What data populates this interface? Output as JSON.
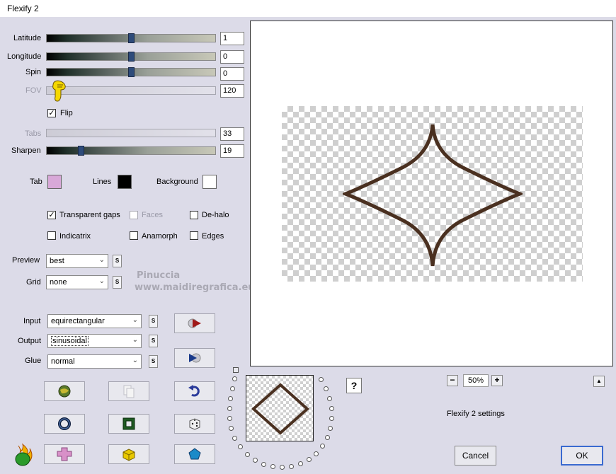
{
  "window": {
    "title": "Flexify 2"
  },
  "sliders": [
    {
      "label": "Latitude",
      "value": "1",
      "level": 0.5,
      "disabled": false
    },
    {
      "label": "Longitude",
      "value": "0",
      "level": 0.5,
      "disabled": false
    },
    {
      "label": "Spin",
      "value": "0",
      "level": 0.5,
      "disabled": false
    },
    {
      "label": "FOV",
      "value": "120",
      "level": 0.05,
      "disabled": true
    },
    {
      "label": "Tabs",
      "value": "33",
      "level": 0.0,
      "disabled": true
    },
    {
      "label": "Sharpen",
      "value": "19",
      "level": 0.2,
      "disabled": false
    }
  ],
  "flip": {
    "label": "Flip",
    "checked": true
  },
  "colors": {
    "tab": {
      "label": "Tab",
      "color": "#d8a8d8"
    },
    "lines": {
      "label": "Lines",
      "color": "#000000"
    },
    "background": {
      "label": "Background",
      "color": "#ffffff"
    }
  },
  "options": {
    "transparent_gaps": {
      "label": "Transparent gaps",
      "checked": true
    },
    "faces": {
      "label": "Faces",
      "checked": false,
      "disabled": true
    },
    "de_halo": {
      "label": "De-halo",
      "checked": false
    },
    "indicatrix": {
      "label": "Indicatrix",
      "checked": false
    },
    "anamorph": {
      "label": "Anamorph",
      "checked": false
    },
    "edges": {
      "label": "Edges",
      "checked": false
    }
  },
  "preview_select": {
    "label": "Preview",
    "value": "best"
  },
  "grid_select": {
    "label": "Grid",
    "value": "none"
  },
  "input_select": {
    "label": "Input",
    "value": "equirectangular"
  },
  "output_select": {
    "label": "Output",
    "value": "sinusoidal"
  },
  "glue_select": {
    "label": "Glue",
    "value": "normal"
  },
  "s_label": "S",
  "watermark": {
    "line1": "Pinuccia",
    "line2": "www.maidiregrafica.eu"
  },
  "zoom": {
    "value": "50%",
    "minus": "−",
    "plus": "+"
  },
  "settings_label": "Flexify 2 settings",
  "help_label": "?",
  "scroll_up": "▲",
  "buttons": {
    "cancel": "Cancel",
    "ok": "OK"
  },
  "accent": {
    "diamond": "#4a3020",
    "thumb": "#2e4b7a"
  }
}
